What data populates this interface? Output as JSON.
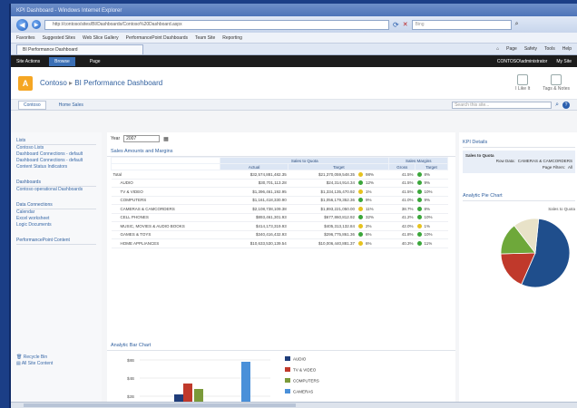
{
  "browser": {
    "window_title": "KPI Dashboard - Windows Internet Explorer",
    "url": "http://contoso/sites/BI/Dashboards/Contoso%20Dashboard.aspx",
    "search_placeholder": "Bing",
    "favorites": [
      "Favorites",
      "Suggested Sites",
      "Web Slice Gallery",
      "PerformancePoint Dashboards",
      "Team Site",
      "Reporting"
    ],
    "tab_label": "BI Performance Dashboard",
    "commands": [
      "Page",
      "Safety",
      "Tools",
      "Help"
    ]
  },
  "ribbon": {
    "site_actions": "Site Actions",
    "tabs": [
      "Browse",
      "Page"
    ],
    "user": "CONTOSO\\administrator",
    "my_site": "My Site"
  },
  "header": {
    "site": "Contoso",
    "breadcrumb": "BI Performance Dashboard",
    "tools": [
      "I Like It",
      "Tags & Notes"
    ]
  },
  "topnav": {
    "items": [
      "Contoso",
      "Home Sales"
    ],
    "search_placeholder": "Search this site..."
  },
  "leftnav": {
    "groups": [
      {
        "title": "Lists",
        "items": [
          "Contoso Lists",
          "Dashboard Connections - default",
          "Dashboard Connections - default",
          "Content Status Indicators"
        ]
      },
      {
        "title": "Dashboards",
        "items": [
          "Contoso operational Dashboards"
        ]
      },
      {
        "title": "Data Connections",
        "items": [
          "Calendar",
          "Excel worksheet",
          "Logic Documents"
        ]
      },
      {
        "title": "PerformancePoint Content",
        "items": []
      }
    ],
    "bottom": [
      "Recycle Bin",
      "All Site Content"
    ]
  },
  "main": {
    "filter_label": "Year",
    "filter_value": "2007",
    "scorecard_title": "Sales Amounts and Margins",
    "headers": {
      "group1": "Sales to Quota",
      "group2": "Sales Margins",
      "actual": "Actual",
      "target": "Target",
      "gross": "Gross",
      "target2": "Target"
    },
    "rows": [
      {
        "name": "Total",
        "actual": "$32,574,881,482.35",
        "target": "$21,370,059,548.35",
        "status": "yellow",
        "pct": "98%",
        "gross": "41.5%",
        "m_status": "green",
        "m_pct": "8%"
      },
      {
        "name": "AUDIO",
        "actual": "$30,701,113.28",
        "target": "$24,314,914.34",
        "status": "green",
        "pct": "12%",
        "gross": "41.5%",
        "m_status": "green",
        "m_pct": "9%"
      },
      {
        "name": "TV & VIDEO",
        "actual": "$1,396,461,192.95",
        "target": "$1,334,135,470.92",
        "status": "yellow",
        "pct": "1%",
        "gross": "41.5%",
        "m_status": "green",
        "m_pct": "10%"
      },
      {
        "name": "COMPUTERS",
        "actual": "$1,161,418,330.90",
        "target": "$1,056,179,352.36",
        "status": "green",
        "pct": "9%",
        "gross": "41.0%",
        "m_status": "green",
        "m_pct": "9%"
      },
      {
        "name": "CAMERAS & CAMCORDERS",
        "actual": "$2,108,738,109.38",
        "target": "$1,893,221,050.00",
        "status": "yellow",
        "pct": "11%",
        "gross": "38.7%",
        "m_status": "green",
        "m_pct": "8%"
      },
      {
        "name": "CELL PHONES",
        "actual": "$893,461,301.93",
        "target": "$677,860,812.92",
        "status": "green",
        "pct": "32%",
        "gross": "41.2%",
        "m_status": "green",
        "m_pct": "10%"
      },
      {
        "name": "MUSIC, MOVIES & AUDIO BOOKS",
        "actual": "$414,173,319.93",
        "target": "$405,313,132.84",
        "status": "yellow",
        "pct": "2%",
        "gross": "42.0%",
        "m_status": "yellow",
        "m_pct": "1%"
      },
      {
        "name": "GAMES & TOYS",
        "actual": "$340,416,432.93",
        "target": "$296,775,861.36",
        "status": "green",
        "pct": "6%",
        "gross": "41.8%",
        "m_status": "green",
        "m_pct": "10%"
      },
      {
        "name": "HOME APPLIANCES",
        "actual": "$10,633,530,139.54",
        "target": "$10,006,440,881.37",
        "status": "yellow",
        "pct": "6%",
        "gross": "40.3%",
        "m_status": "green",
        "m_pct": "11%"
      }
    ],
    "chart_title": "Analytic Bar Chart",
    "chart_legend": [
      "AUDIO",
      "TV & VIDEO",
      "COMPUTERS",
      "CAMERAS"
    ],
    "chart_ticks": [
      "$8B",
      "$4B",
      "$2B"
    ]
  },
  "right": {
    "kpi_title": "KPI Details",
    "kpi_name": "Sales to Quota",
    "rows": [
      {
        "label": "Row Data:",
        "value": "CAMERAS & CAMCORDERS"
      },
      {
        "label": "Page Filters:",
        "value": "All"
      }
    ],
    "pie_title": "Analytic Pie Chart",
    "pie_caption": "Sales to Quota"
  },
  "chart_data": [
    {
      "type": "bar",
      "title": "Analytic Bar Chart",
      "series": [
        {
          "name": "AUDIO",
          "values": [
            0.9
          ]
        },
        {
          "name": "TV & VIDEO",
          "values": [
            1.5
          ]
        },
        {
          "name": "COMPUTERS",
          "values": [
            1.2
          ]
        },
        {
          "name": "CAMERAS",
          "values": [
            2.7
          ]
        }
      ],
      "categories": [
        ""
      ],
      "ylabel": "",
      "xlabel": ""
    },
    {
      "type": "pie",
      "title": "Sales to Quota",
      "categories": [
        "Navy",
        "Red",
        "Green",
        "Beige"
      ],
      "values": [
        55,
        18,
        15,
        12
      ]
    }
  ],
  "colors": {
    "pie": [
      "#1f4e8c",
      "#c0392b",
      "#6ea83a",
      "#e8e2c8"
    ],
    "bars": [
      "#1f3d7a",
      "#c0392b",
      "#7b9a3a",
      "#4a90d9"
    ]
  }
}
